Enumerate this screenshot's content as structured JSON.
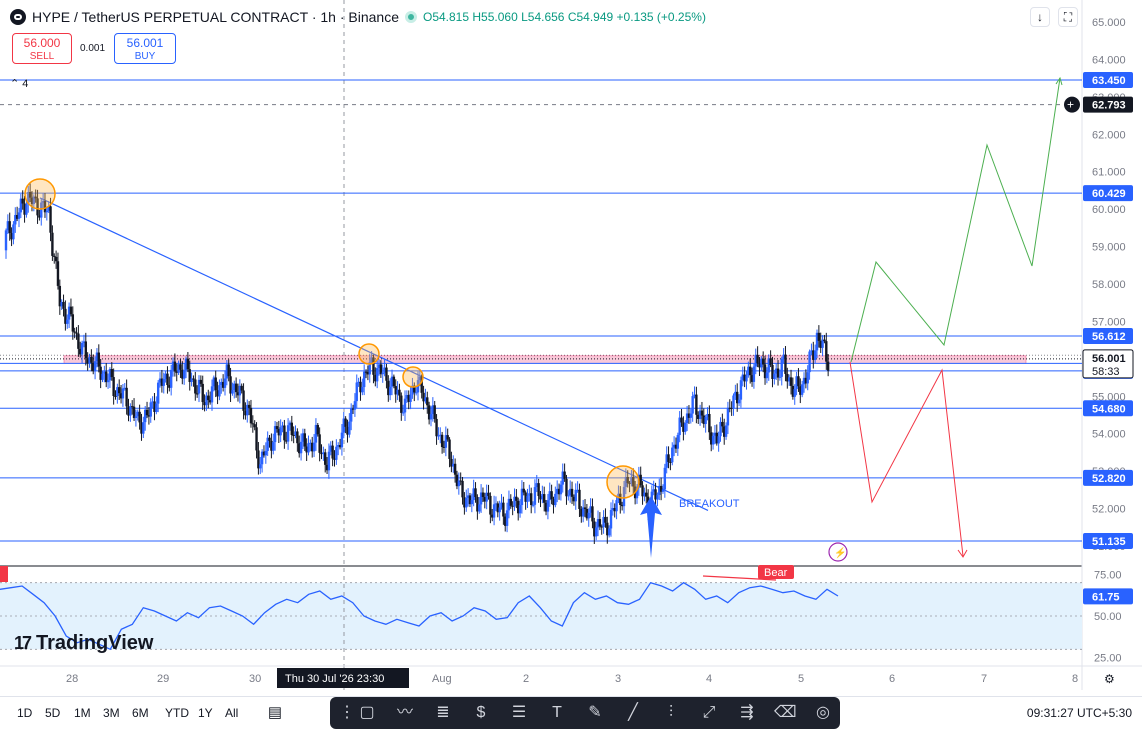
{
  "header": {
    "title": "HYPE / TetherUS PERPETUAL CONTRACT · 1h · Binance",
    "open": "O54.815",
    "high": "H55.060",
    "low": "L54.656",
    "close": "C54.949",
    "change": "+0.135 (+0.25%)"
  },
  "trade": {
    "sell_price": "56.000",
    "sell_label": "SELL",
    "spread": "0.001",
    "buy_price": "56.001",
    "buy_label": "BUY"
  },
  "indicator_count": "4",
  "top_buttons": {
    "down": "↓",
    "fullscreen": "⛶"
  },
  "annotations": {
    "breakout": "BREAKOUT",
    "bear": "Bear"
  },
  "crosshair_label": "Thu 30 Jul '26   23:30",
  "timeframes": [
    "1D",
    "5D",
    "1M",
    "3M",
    "6M",
    "YTD",
    "1Y",
    "All"
  ],
  "clock": "09:31:27 UTC+5:30",
  "logo_text": "TradingView",
  "colors": {
    "level_line": "#2962ff",
    "up": "#2962ff",
    "down": "#131722",
    "bull_path": "#4caf50",
    "bear_path": "#f23645",
    "highlight": "#f8bbd0",
    "circle": "#ff9800",
    "rsi_band": "#e3f2fd",
    "rsi_line": "#2962ff"
  },
  "chart_data": [
    {
      "type": "candlestick",
      "symbol": "HYPE/USDT.P",
      "interval": "1h",
      "ylim": [
        50.2,
        65.3
      ],
      "y_ticks": [
        "65.000",
        "64.000",
        "63.000",
        "62.000",
        "61.000",
        "60.000",
        "59.000",
        "58.000",
        "57.000",
        "56.000",
        "55.000",
        "54.000",
        "53.000",
        "52.000",
        "51.000"
      ],
      "x_ticks": [
        "28",
        "29",
        "30",
        "Aug",
        "2",
        "3",
        "4",
        "5",
        "6",
        "7",
        "8"
      ],
      "horizontal_levels": [
        "63.450",
        "60.429",
        "56.612",
        "55.878",
        "55.680",
        "54.680",
        "52.820",
        "51.135"
      ],
      "current_price": "56.001",
      "countdown": "58:33",
      "alert_price": "62.793",
      "close_path": [
        59.2,
        59.7,
        60.3,
        60.1,
        59.9,
        57.5,
        57.0,
        56.2,
        55.9,
        55.6,
        55.2,
        54.9,
        54.3,
        54.5,
        55.3,
        55.6,
        55.8,
        55.4,
        54.9,
        55.2,
        55.5,
        55.1,
        54.6,
        53.2,
        53.9,
        54.1,
        54.0,
        53.6,
        53.9,
        53.2,
        53.7,
        54.4,
        55.4,
        55.8,
        55.6,
        55.2,
        54.7,
        55.4,
        54.8,
        54.0,
        53.5,
        52.4,
        52.2,
        52.3,
        52.0,
        51.9,
        52.2,
        52.3,
        52.4,
        52.1,
        52.7,
        52.4,
        52.0,
        51.6,
        51.5,
        52.1,
        52.7,
        52.6,
        52.1,
        52.6,
        53.6,
        54.3,
        54.8,
        54.3,
        53.8,
        54.5,
        55.2,
        55.7,
        55.9,
        55.6,
        55.8,
        55.1,
        55.5,
        56.6,
        56.0
      ]
    },
    {
      "type": "line",
      "name": "RSI",
      "ylim": [
        20,
        80
      ],
      "y_ticks": [
        "75.00",
        "50.00",
        "25.00"
      ],
      "current_value": "61.75",
      "values": [
        66,
        67,
        68,
        63,
        58,
        50,
        38,
        34,
        36,
        33,
        30,
        42,
        45,
        55,
        53,
        50,
        47,
        52,
        49,
        55,
        56,
        53,
        50,
        45,
        52,
        57,
        60,
        58,
        63,
        65,
        60,
        62,
        58,
        50,
        47,
        45,
        48,
        46,
        44,
        50,
        52,
        47,
        50,
        55,
        53,
        48,
        49,
        58,
        62,
        55,
        47,
        44,
        58,
        64,
        60,
        62,
        58,
        57,
        60,
        70,
        68,
        65,
        70,
        66,
        60,
        62,
        58,
        64,
        67,
        68,
        66,
        64,
        65,
        62,
        60,
        66,
        62
      ]
    }
  ]
}
